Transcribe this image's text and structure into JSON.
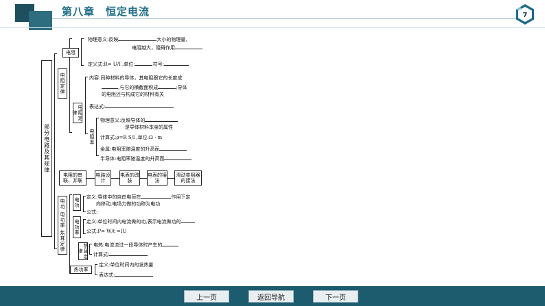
{
  "header": {
    "chapter_title": "第八章　恒定电流",
    "page_number": "7"
  },
  "mindmap": {
    "root": "部分电路及其规律",
    "resistance": {
      "label": "电阻",
      "def_and_law": "电阻定律",
      "physical_meaning_a": "物理意义:反映",
      "physical_meaning_b": "大小的物理量,",
      "physical_meaning_c": "电阻越大，阻碍作用",
      "definition": "定义式:R= U/I ,单位:",
      "symbol": ",符号:"
    },
    "resistance_law": {
      "label": "电阻定律",
      "content_a": "内容:同种材料的导体，其电阻跟它的长度成",
      "content_b": ",与它的横截面积成",
      "content_c": ";导体",
      "content_d": "的电阻还与构成它的材料有关",
      "expression": "表达式:"
    },
    "resistivity": {
      "label": "电阻率",
      "meaning_a": "物理意义:反映导体的",
      "meaning_b": "是导体材料本身的属性",
      "calc": "计算式:ρ=R S/l ,单位:Ω · m",
      "metal": "金属:电阻率随温度的升高而",
      "semiconductor": "半导体:电阻率随温度的升高而"
    },
    "middle_row": [
      "电阻的串联、并联",
      "电路设计",
      "电表的改装",
      "电表的接法",
      "滑动变阻器的接法"
    ],
    "power": {
      "group_label": "电功 电功率 焦耳定律",
      "work_label": "电功",
      "work_def_a": "定义:导体中的自由电荷在",
      "work_def_b": "作用下定",
      "work_def_c": "向移动,电场力做的功称为电功",
      "work_formula": "公式:",
      "power_label": "电功率",
      "power_def": "定义:单位时间内电流做的功,表示电流做功的",
      "power_formula": "公式:P= W/t =IU",
      "joule_label": "焦耳定律",
      "joule_heat": "电热:电流流过一段导体时产生的",
      "joule_calc": "计算式:",
      "heat_power_label": "热功率",
      "heat_def": "定义:单位时间内的发热量",
      "heat_expr": "表达式:"
    }
  },
  "footer": {
    "prev": "上一页",
    "back": "返回导航",
    "next": "下一页"
  }
}
